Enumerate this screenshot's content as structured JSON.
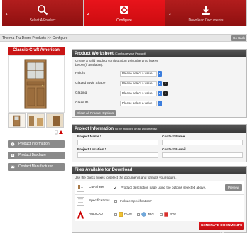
{
  "steps": [
    {
      "num": "1",
      "label": "Select A Product",
      "icon": "search-icon"
    },
    {
      "num": "2",
      "label": "Configure",
      "icon": "configure-icon",
      "active": true
    },
    {
      "num": "3",
      "label": "Download Documents",
      "icon": "download-icon"
    }
  ],
  "breadcrumb": "Therma-Tru Doors Products >> Configure",
  "back_label": "Go Back",
  "product": {
    "title": "Classic-Craft American"
  },
  "side_buttons": [
    {
      "label": "Product Information",
      "icon": "info-icon"
    },
    {
      "label": "Product Brochure",
      "icon": "brochure-icon"
    },
    {
      "label": "Contact Manufacturer",
      "icon": "contact-icon"
    }
  ],
  "worksheet": {
    "title": "Product Worksheet",
    "subtitle": "(Configure your Product)",
    "intro": "Create a valid product configuration using the drop boxes below (if available).",
    "rows": [
      {
        "label": "Height",
        "value": "Please select a value"
      },
      {
        "label": "Glazed Style Shape",
        "value": "Please select a value"
      },
      {
        "label": "Glazing",
        "value": "Please select a value"
      },
      {
        "label": "Glass ID",
        "value": "Please select a value"
      }
    ],
    "clear_label": "Clear all Product Options"
  },
  "project_info": {
    "title": "Project Information",
    "subtitle": "(to be included on all Documents)",
    "fields": {
      "project_name": "Project Name *",
      "contact_name": "Contact Name",
      "project_location": "Project Location *",
      "contact_email": "Contact E-mail"
    }
  },
  "files": {
    "title": "Files Available for Download",
    "intro": "Use the check boxes to select the documents and formats you require.",
    "cut_sheet": {
      "name": "Cut-Sheet",
      "desc": "Product description page using the options selected above.",
      "preview": "Preview"
    },
    "specifications": {
      "name": "Specifications",
      "desc": "Include Specification?"
    },
    "autocad": {
      "name": "AutoCAD",
      "formats": [
        "DWG",
        "JPG",
        "PDF"
      ]
    },
    "generate_label": "GENERATE DOCUMENTS >>"
  },
  "colors": {
    "brand_red": "#d3121a",
    "panel_header": "#444444"
  }
}
